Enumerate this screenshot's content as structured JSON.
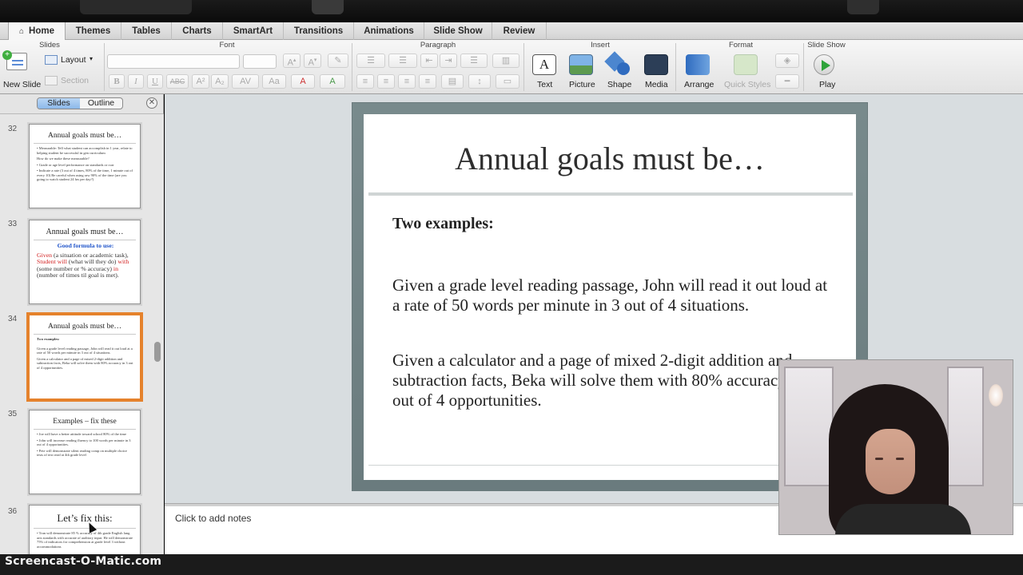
{
  "tabs": [
    {
      "label": "Home",
      "active": true
    },
    {
      "label": "Themes"
    },
    {
      "label": "Tables"
    },
    {
      "label": "Charts"
    },
    {
      "label": "SmartArt"
    },
    {
      "label": "Transitions"
    },
    {
      "label": "Animations"
    },
    {
      "label": "Slide Show"
    },
    {
      "label": "Review"
    }
  ],
  "ribbon": {
    "groups": {
      "slides": "Slides",
      "font": "Font",
      "paragraph": "Paragraph",
      "insert": "Insert",
      "format": "Format",
      "slideshow": "Slide Show"
    },
    "new_slide": "New Slide",
    "layout": "Layout",
    "section": "Section",
    "text": "Text",
    "picture": "Picture",
    "shape": "Shape",
    "media": "Media",
    "arrange": "Arrange",
    "quick_styles": "Quick Styles",
    "play": "Play"
  },
  "sidebar": {
    "tab_slides": "Slides",
    "tab_outline": "Outline",
    "close": "✕",
    "thumbs": [
      {
        "num": "32",
        "title": "Annual goals must be…",
        "body": [
          "• Measurable: Tell what student can accomplish in 1 year, relate to helping student be successful in gen curriculum",
          "How do we make these measurable?",
          "• Grade or age level performance on standards or curr",
          "• Indicate a rate (3 out of 4 times, 80% of the time, 1 minute out of every 10) Be careful when using raw 90% of the time (are you going to watch student 24 hrs per day?)"
        ]
      },
      {
        "num": "33",
        "title": "Annual goals must be…",
        "formula": "Good formula to use:",
        "given": "Given",
        "part1": " (a situation or academic task), ",
        "student_will": "Student will",
        "part2": " (what will they do) ",
        "with": "with",
        "part3": " (some number or % accuracy) ",
        "in": "in",
        "part4": " (number of times til goal is met)."
      },
      {
        "num": "34",
        "title": "Annual goals must be…",
        "body": [
          "Two examples:",
          "Given a grade level reading passage, John will read it out loud at a rate of 50 words per minute in 3 out of 4 situations.",
          "Given a calculator and a page of mixed 2-digit addition and subtraction facts, Beka will solve them with 80% accuracy in 3 out of 4 opportunities."
        ]
      },
      {
        "num": "35",
        "title": "Examples – fix these",
        "body": [
          "• Joe will have a better attitude toward school 80% of the time",
          "• John will increase reading fluency to 100 words per minute in 3 out of 4 opportunities.",
          "• Pete will demonstrate silent reading comp on multiple choice tests of text read at 4th grade level"
        ]
      },
      {
        "num": "36",
        "title": "Let’s fix this:",
        "body": [
          "• Tran will demonstrate 85 % accuracy of 4th grade English lang arts standards with accurate of auditory input. He will demonstrate 75% of indicators for comprehension at grade level 3 without accommodations"
        ]
      }
    ]
  },
  "slide": {
    "title": "Annual goals must be…",
    "subtitle": "Two examples:",
    "para1": "Given a grade level reading passage, John will read it out loud at a rate of 50 words per minute in 3 out of 4 situations.",
    "para2": "Given a calculator and a page of mixed 2-digit addition and subtraction facts, Beka will solve them with 80% accuracy in 3 out of 4 opportunities."
  },
  "notes_placeholder": "Click to add notes",
  "watermark": "Screencast-O-Matic.com",
  "colors": {
    "selected_thumb": "#e5822c",
    "formula_blue": "#1d52c9",
    "formula_red": "#d32020"
  }
}
